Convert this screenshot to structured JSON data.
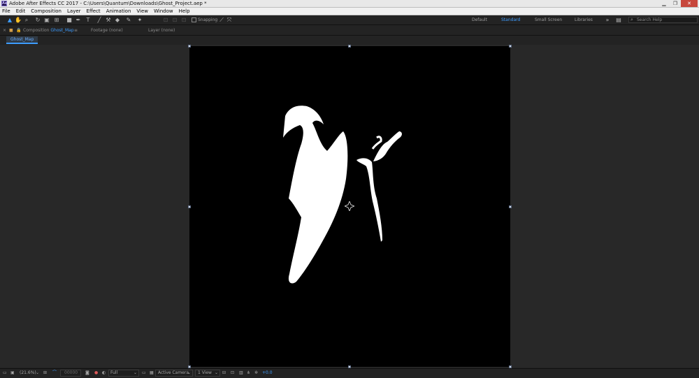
{
  "window": {
    "title": "Adobe After Effects CC 2017 - C:\\Users\\Quantum\\Downloads\\Ghost_Project.aep *",
    "logo_text": "Ae",
    "controls": [
      "minimize",
      "restore",
      "close"
    ]
  },
  "menu": [
    "File",
    "Edit",
    "Composition",
    "Layer",
    "Effect",
    "Animation",
    "View",
    "Window",
    "Help"
  ],
  "tools": [
    {
      "name": "selection-tool",
      "glyph": "▲",
      "active": true
    },
    {
      "name": "hand-tool",
      "glyph": "✋"
    },
    {
      "name": "zoom-tool",
      "glyph": "⌕"
    },
    {
      "name": "rotation-tool",
      "glyph": "↻"
    },
    {
      "name": "camera-tool",
      "glyph": "▣"
    },
    {
      "name": "pan-behind-tool",
      "glyph": "⊞"
    },
    {
      "name": "rectangle-tool",
      "glyph": "■"
    },
    {
      "name": "pen-tool",
      "glyph": "✒"
    },
    {
      "name": "type-tool",
      "glyph": "T"
    },
    {
      "name": "brush-tool",
      "glyph": "╱"
    },
    {
      "name": "clone-stamp-tool",
      "glyph": "⚒"
    },
    {
      "name": "eraser-tool",
      "glyph": "◆"
    },
    {
      "name": "roto-brush-tool",
      "glyph": "✎"
    },
    {
      "name": "puppet-pin-tool",
      "glyph": "✦"
    }
  ],
  "snapping": {
    "label": "Snapping"
  },
  "workspaces": [
    {
      "label": "Default",
      "active": false
    },
    {
      "label": "Standard",
      "active": true
    },
    {
      "label": "Small Screen",
      "active": false
    },
    {
      "label": "Libraries",
      "active": false
    }
  ],
  "search": {
    "placeholder": "Search Help"
  },
  "panel": {
    "composition_prefix": "Composition",
    "composition_name": "Ghost_Map",
    "menu_glyph": "≡",
    "footage_tab": "Footage (none)",
    "layer_tab": "Layer (none)",
    "active_subtab": "Ghost_Map"
  },
  "status": {
    "zoom": "(21.6%)",
    "timecode": "00000",
    "resolution": "Full",
    "view": "Active Camera",
    "views_count": "1 View",
    "exposure": "+0.0"
  },
  "colors": {
    "accent": "#3d9cff",
    "background": "#232323",
    "composition": "#000000"
  }
}
